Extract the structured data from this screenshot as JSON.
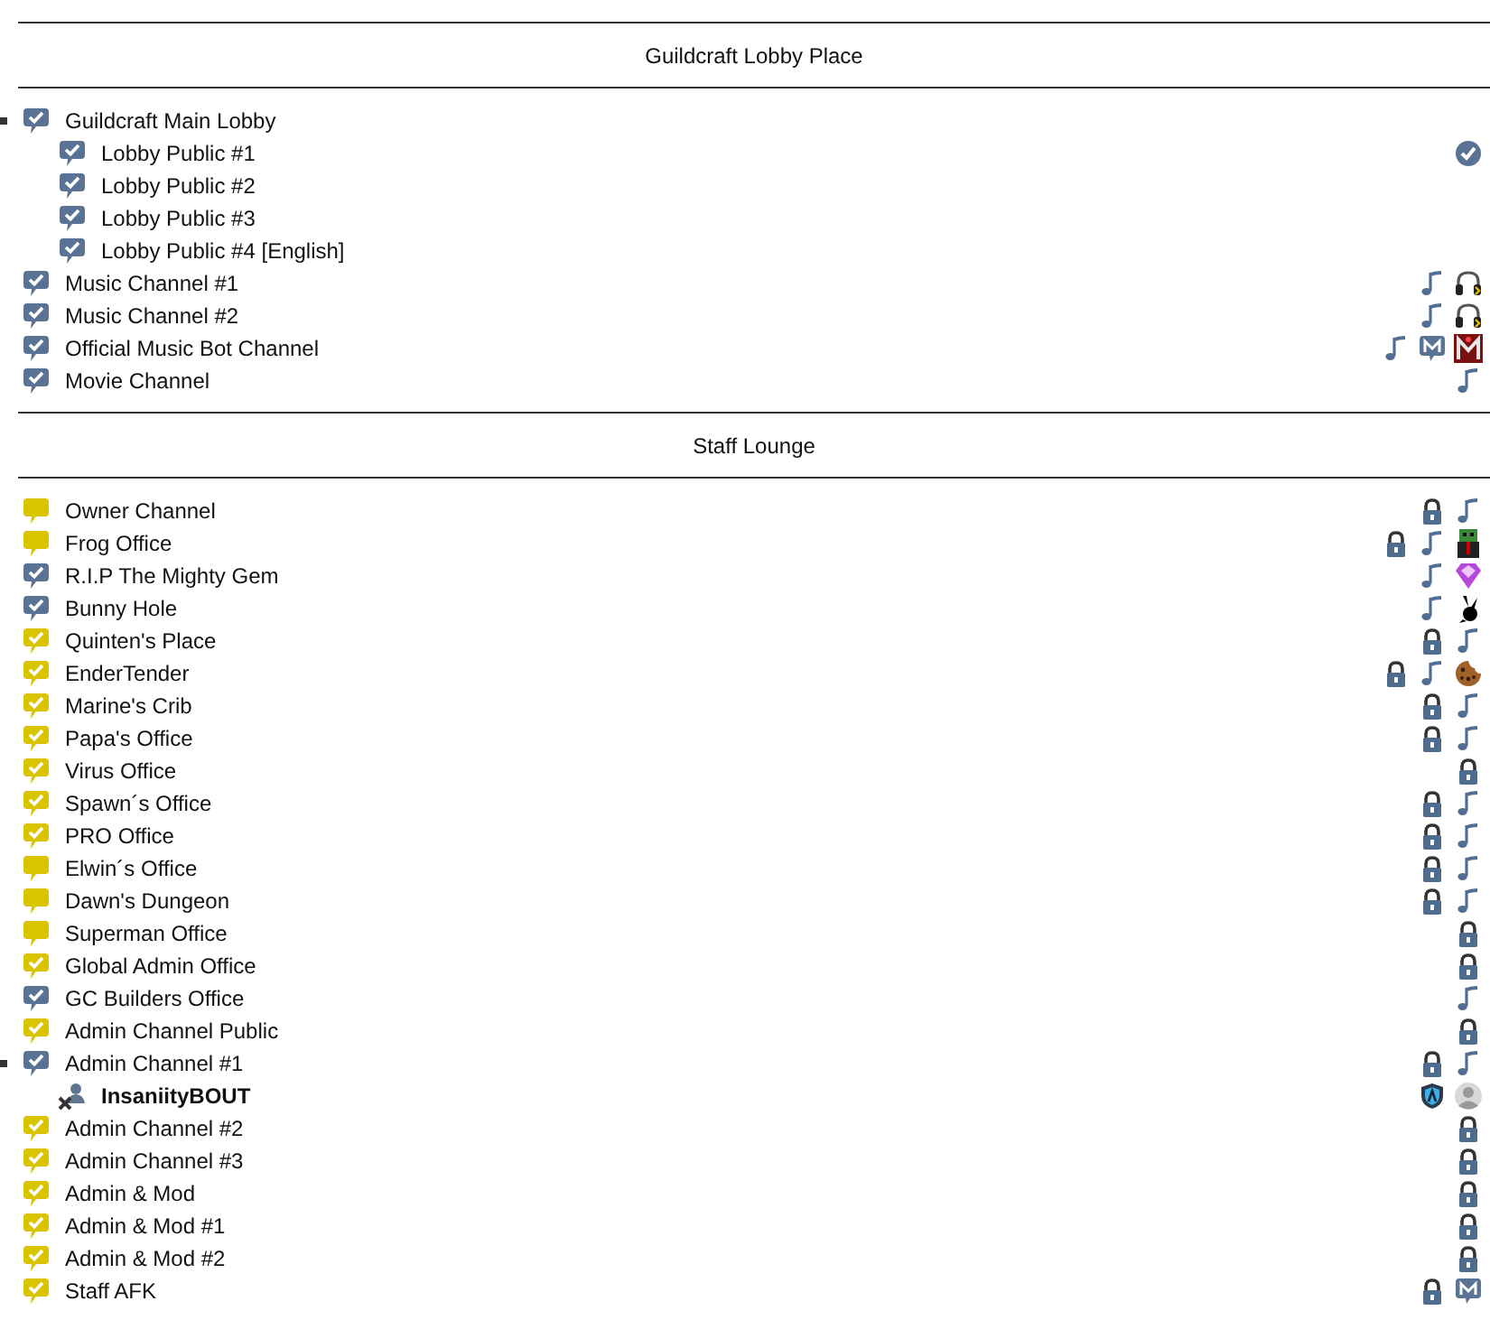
{
  "sections": [
    {
      "title": "Guildcraft Lobby Place",
      "channels": [
        {
          "name": "Guildcraft Main Lobby",
          "kind": "blue-check",
          "expanded": true,
          "children": [
            {
              "name": "Lobby Public #1",
              "kind": "blue-check",
              "icons": [
                {
                  "kind": "check-badge"
                }
              ]
            },
            {
              "name": "Lobby Public #2",
              "kind": "blue-check"
            },
            {
              "name": "Lobby Public #3",
              "kind": "blue-check"
            },
            {
              "name": "Lobby Public #4 [English]",
              "kind": "blue-check"
            }
          ]
        },
        {
          "name": "Music Channel #1",
          "kind": "blue-check",
          "icons": [
            {
              "kind": "music"
            },
            {
              "kind": "headphones"
            }
          ]
        },
        {
          "name": "Music Channel #2",
          "kind": "blue-check",
          "icons": [
            {
              "kind": "music"
            },
            {
              "kind": "headphones"
            }
          ]
        },
        {
          "name": "Official Music Bot Channel",
          "kind": "blue-check",
          "icons": [
            {
              "kind": "music"
            },
            {
              "kind": "m-bubble"
            },
            {
              "kind": "m-logo"
            }
          ]
        },
        {
          "name": "Movie Channel",
          "kind": "blue-check",
          "icons": [
            {
              "kind": "music"
            }
          ]
        }
      ]
    },
    {
      "title": "Staff Lounge",
      "channels": [
        {
          "name": "Owner Channel",
          "kind": "yellow",
          "icons": [
            {
              "kind": "lock"
            },
            {
              "kind": "music"
            }
          ]
        },
        {
          "name": "Frog Office",
          "kind": "yellow",
          "icons": [
            {
              "kind": "lock"
            },
            {
              "kind": "music"
            },
            {
              "kind": "creeper"
            }
          ]
        },
        {
          "name": "R.I.P The Mighty Gem",
          "kind": "blue-check",
          "icons": [
            {
              "kind": "music"
            },
            {
              "kind": "gem"
            }
          ]
        },
        {
          "name": "Bunny Hole",
          "kind": "blue-check",
          "icons": [
            {
              "kind": "music"
            },
            {
              "kind": "bunny"
            }
          ]
        },
        {
          "name": "Quinten's Place",
          "kind": "yellow-check",
          "icons": [
            {
              "kind": "lock"
            },
            {
              "kind": "music"
            }
          ]
        },
        {
          "name": "EnderTender",
          "kind": "yellow-check",
          "icons": [
            {
              "kind": "lock"
            },
            {
              "kind": "music"
            },
            {
              "kind": "cookie"
            }
          ]
        },
        {
          "name": "Marine's Crib",
          "kind": "yellow-check",
          "icons": [
            {
              "kind": "lock"
            },
            {
              "kind": "music"
            }
          ]
        },
        {
          "name": "Papa's Office",
          "kind": "yellow-check",
          "icons": [
            {
              "kind": "lock"
            },
            {
              "kind": "music"
            }
          ]
        },
        {
          "name": "Virus Office",
          "kind": "yellow-check",
          "icons": [
            {
              "kind": "lock"
            }
          ]
        },
        {
          "name": "Spawn´s Office",
          "kind": "yellow-check",
          "icons": [
            {
              "kind": "lock"
            },
            {
              "kind": "music"
            }
          ]
        },
        {
          "name": "PRO Office",
          "kind": "yellow-check",
          "icons": [
            {
              "kind": "lock"
            },
            {
              "kind": "music"
            }
          ]
        },
        {
          "name": "Elwin´s Office",
          "kind": "yellow",
          "icons": [
            {
              "kind": "lock"
            },
            {
              "kind": "music"
            }
          ]
        },
        {
          "name": "Dawn's Dungeon",
          "kind": "yellow",
          "icons": [
            {
              "kind": "lock"
            },
            {
              "kind": "music"
            }
          ]
        },
        {
          "name": "Superman Office",
          "kind": "yellow",
          "icons": [
            {
              "kind": "lock"
            }
          ]
        },
        {
          "name": "Global Admin Office",
          "kind": "yellow-check",
          "icons": [
            {
              "kind": "lock"
            }
          ]
        },
        {
          "name": "GC Builders Office",
          "kind": "blue-check",
          "icons": [
            {
              "kind": "music"
            }
          ]
        },
        {
          "name": "Admin Channel Public",
          "kind": "yellow-check",
          "icons": [
            {
              "kind": "lock"
            }
          ]
        },
        {
          "name": "Admin Channel #1",
          "kind": "blue-check",
          "expanded": true,
          "icons": [
            {
              "kind": "lock"
            },
            {
              "kind": "music"
            }
          ],
          "children": [
            {
              "name": "InsaniityBOUT",
              "kind": "client",
              "icons": [
                {
                  "kind": "shield"
                },
                {
                  "kind": "avatar"
                }
              ]
            }
          ]
        },
        {
          "name": "Admin Channel #2",
          "kind": "yellow-check",
          "icons": [
            {
              "kind": "lock"
            }
          ]
        },
        {
          "name": "Admin Channel #3",
          "kind": "yellow-check",
          "icons": [
            {
              "kind": "lock"
            }
          ]
        },
        {
          "name": "Admin & Mod",
          "kind": "yellow-check",
          "icons": [
            {
              "kind": "lock"
            }
          ]
        },
        {
          "name": "Admin & Mod #1",
          "kind": "yellow-check",
          "icons": [
            {
              "kind": "lock"
            }
          ]
        },
        {
          "name": "Admin & Mod #2",
          "kind": "yellow-check",
          "icons": [
            {
              "kind": "lock"
            }
          ]
        },
        {
          "name": "Staff AFK",
          "kind": "yellow-check",
          "icons": [
            {
              "kind": "lock"
            },
            {
              "kind": "m-bubble"
            }
          ]
        }
      ]
    }
  ]
}
